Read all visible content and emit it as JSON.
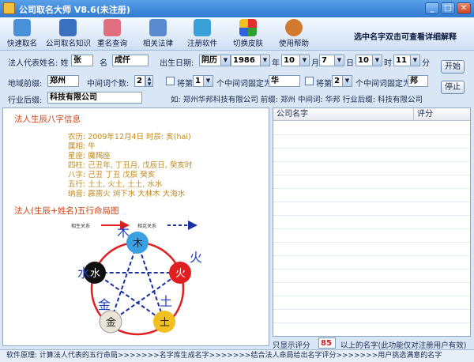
{
  "window": {
    "title": "公司取名大师 V8.6(未注册)"
  },
  "toolbar": {
    "items": [
      {
        "label": "快速取名",
        "icon": "quick-name-icon"
      },
      {
        "label": "公司取名知识",
        "icon": "knowledge-book-icon"
      },
      {
        "label": "重名查询",
        "icon": "duplicate-search-icon"
      },
      {
        "label": "相关法律",
        "icon": "law-book-icon"
      },
      {
        "label": "注册软件",
        "icon": "register-key-icon"
      },
      {
        "label": "切换皮肤",
        "icon": "skin-switch-icon"
      },
      {
        "label": "使用帮助",
        "icon": "help-icon"
      }
    ],
    "hint": "选中名字双击可查看详细解释"
  },
  "form": {
    "rep_label": "法人代表姓名: 姓",
    "surname": "张",
    "given_label": "名",
    "given_name": "成仟",
    "birth_label": "出生日期:",
    "calendar": "阴历",
    "year": "1986",
    "year_unit": "年",
    "month": "10",
    "month_unit": "月",
    "day": "7",
    "day_unit": "日",
    "hour": "10",
    "hour_unit": "时",
    "minute": "11",
    "minute_unit": "分",
    "start_button": "开始",
    "prefix_label": "地域前缀:",
    "prefix_value": "郑州",
    "middle_count_label": "中间词个数:",
    "middle_count": "2",
    "fix_label_1": "将第",
    "fix_index_1": "1",
    "fix_text_1": "个中间词固定为",
    "fix_value_1": "华",
    "fix_label_2": "将第",
    "fix_index_2": "2",
    "fix_text_2": "个中间词固定为",
    "fix_value_2": "邦",
    "suffix_label": "行业后缀:",
    "suffix_value": "科技有限公司",
    "example": "如: 郑州华邦科技有限公司  前缀: 郑州  中间词: 华邦  行业后缀: 科技有限公司",
    "stop_button": "停止"
  },
  "bazi": {
    "section_title": "法人生辰八字信息",
    "lines": [
      "农历: 2009年12月4日  时辰: 亥(hai)",
      "属相: 牛",
      "星座: 魔羯座",
      "四柱: 己丑年, 丁丑月, 戊辰日, 癸亥时",
      "八字: 己丑 丁丑 戊辰 癸亥",
      "五行: 土土, 火土, 土土, 水水",
      "纳音: 霹雳火 涧下水 大林木 大海水"
    ]
  },
  "wuxing": {
    "section_title": "法人(生辰+姓名)五行命局图",
    "legend_generate": "相生关系",
    "legend_overcome": "相克关系",
    "elements": [
      {
        "key": "wood",
        "label": "木",
        "color": "#3aa0e0"
      },
      {
        "key": "fire",
        "label": "火",
        "color": "#e02020"
      },
      {
        "key": "earth",
        "label": "土",
        "color": "#f0c020"
      },
      {
        "key": "metal",
        "label": "金",
        "color": "#e8e4d8"
      },
      {
        "key": "water",
        "label": "水",
        "color": "#101010"
      }
    ],
    "outer_labels": [
      "木",
      "火",
      "土",
      "金",
      "水"
    ]
  },
  "results": {
    "columns": [
      "公司名字",
      "评分"
    ],
    "rows": []
  },
  "filter": {
    "label_before": "只显示评分",
    "score": "85",
    "label_after": "以上的名字(此功能仅对注册用户有效)"
  },
  "status": "软件原理: 计算法人代表的五行命局>>>>>>>名字库生成名字>>>>>>>结合法人命局给出名字评分>>>>>>>用户挑选满意的名字",
  "colors": {
    "titlebar": "#2f7ad0",
    "panel": "#d8e6f6",
    "accent_red": "#d04010",
    "bazi_text": "#c08a20"
  }
}
